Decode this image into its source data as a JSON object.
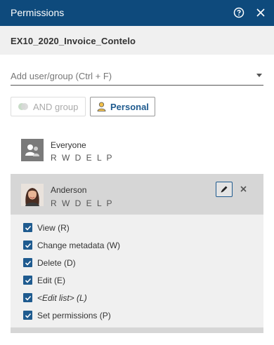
{
  "window": {
    "title": "Permissions"
  },
  "document": {
    "name": "EX10_2020_Invoice_Contelo"
  },
  "search": {
    "placeholder": "Add user/group (Ctrl + F)",
    "value": ""
  },
  "buttons": {
    "and_group": "AND group",
    "personal": "Personal"
  },
  "entries": [
    {
      "name": "Everyone",
      "rights": "R W D E L P",
      "avatar": "group-avatar-icon"
    },
    {
      "name": "Anderson",
      "rights": "R W D E L P",
      "avatar": "user-photo"
    }
  ],
  "permissions": [
    {
      "label": "View (R)",
      "checked": true,
      "italic": false
    },
    {
      "label": "Change metadata (W)",
      "checked": true,
      "italic": false
    },
    {
      "label": "Delete (D)",
      "checked": true,
      "italic": false
    },
    {
      "label": "Edit (E)",
      "checked": true,
      "italic": false
    },
    {
      "label": "<Edit list> (L)",
      "checked": true,
      "italic": true
    },
    {
      "label": "Set permissions (P)",
      "checked": true,
      "italic": false
    }
  ],
  "colors": {
    "titlebar": "#0e4a7c",
    "accent": "#1f5b8f",
    "selected_row": "#d6d6d6",
    "panel": "#f0f0f0"
  },
  "icons": {
    "help": "help-icon",
    "close": "close-icon",
    "and_group": "venn-icon",
    "personal": "person-icon",
    "edit": "pencil-icon",
    "remove": "remove-icon"
  }
}
